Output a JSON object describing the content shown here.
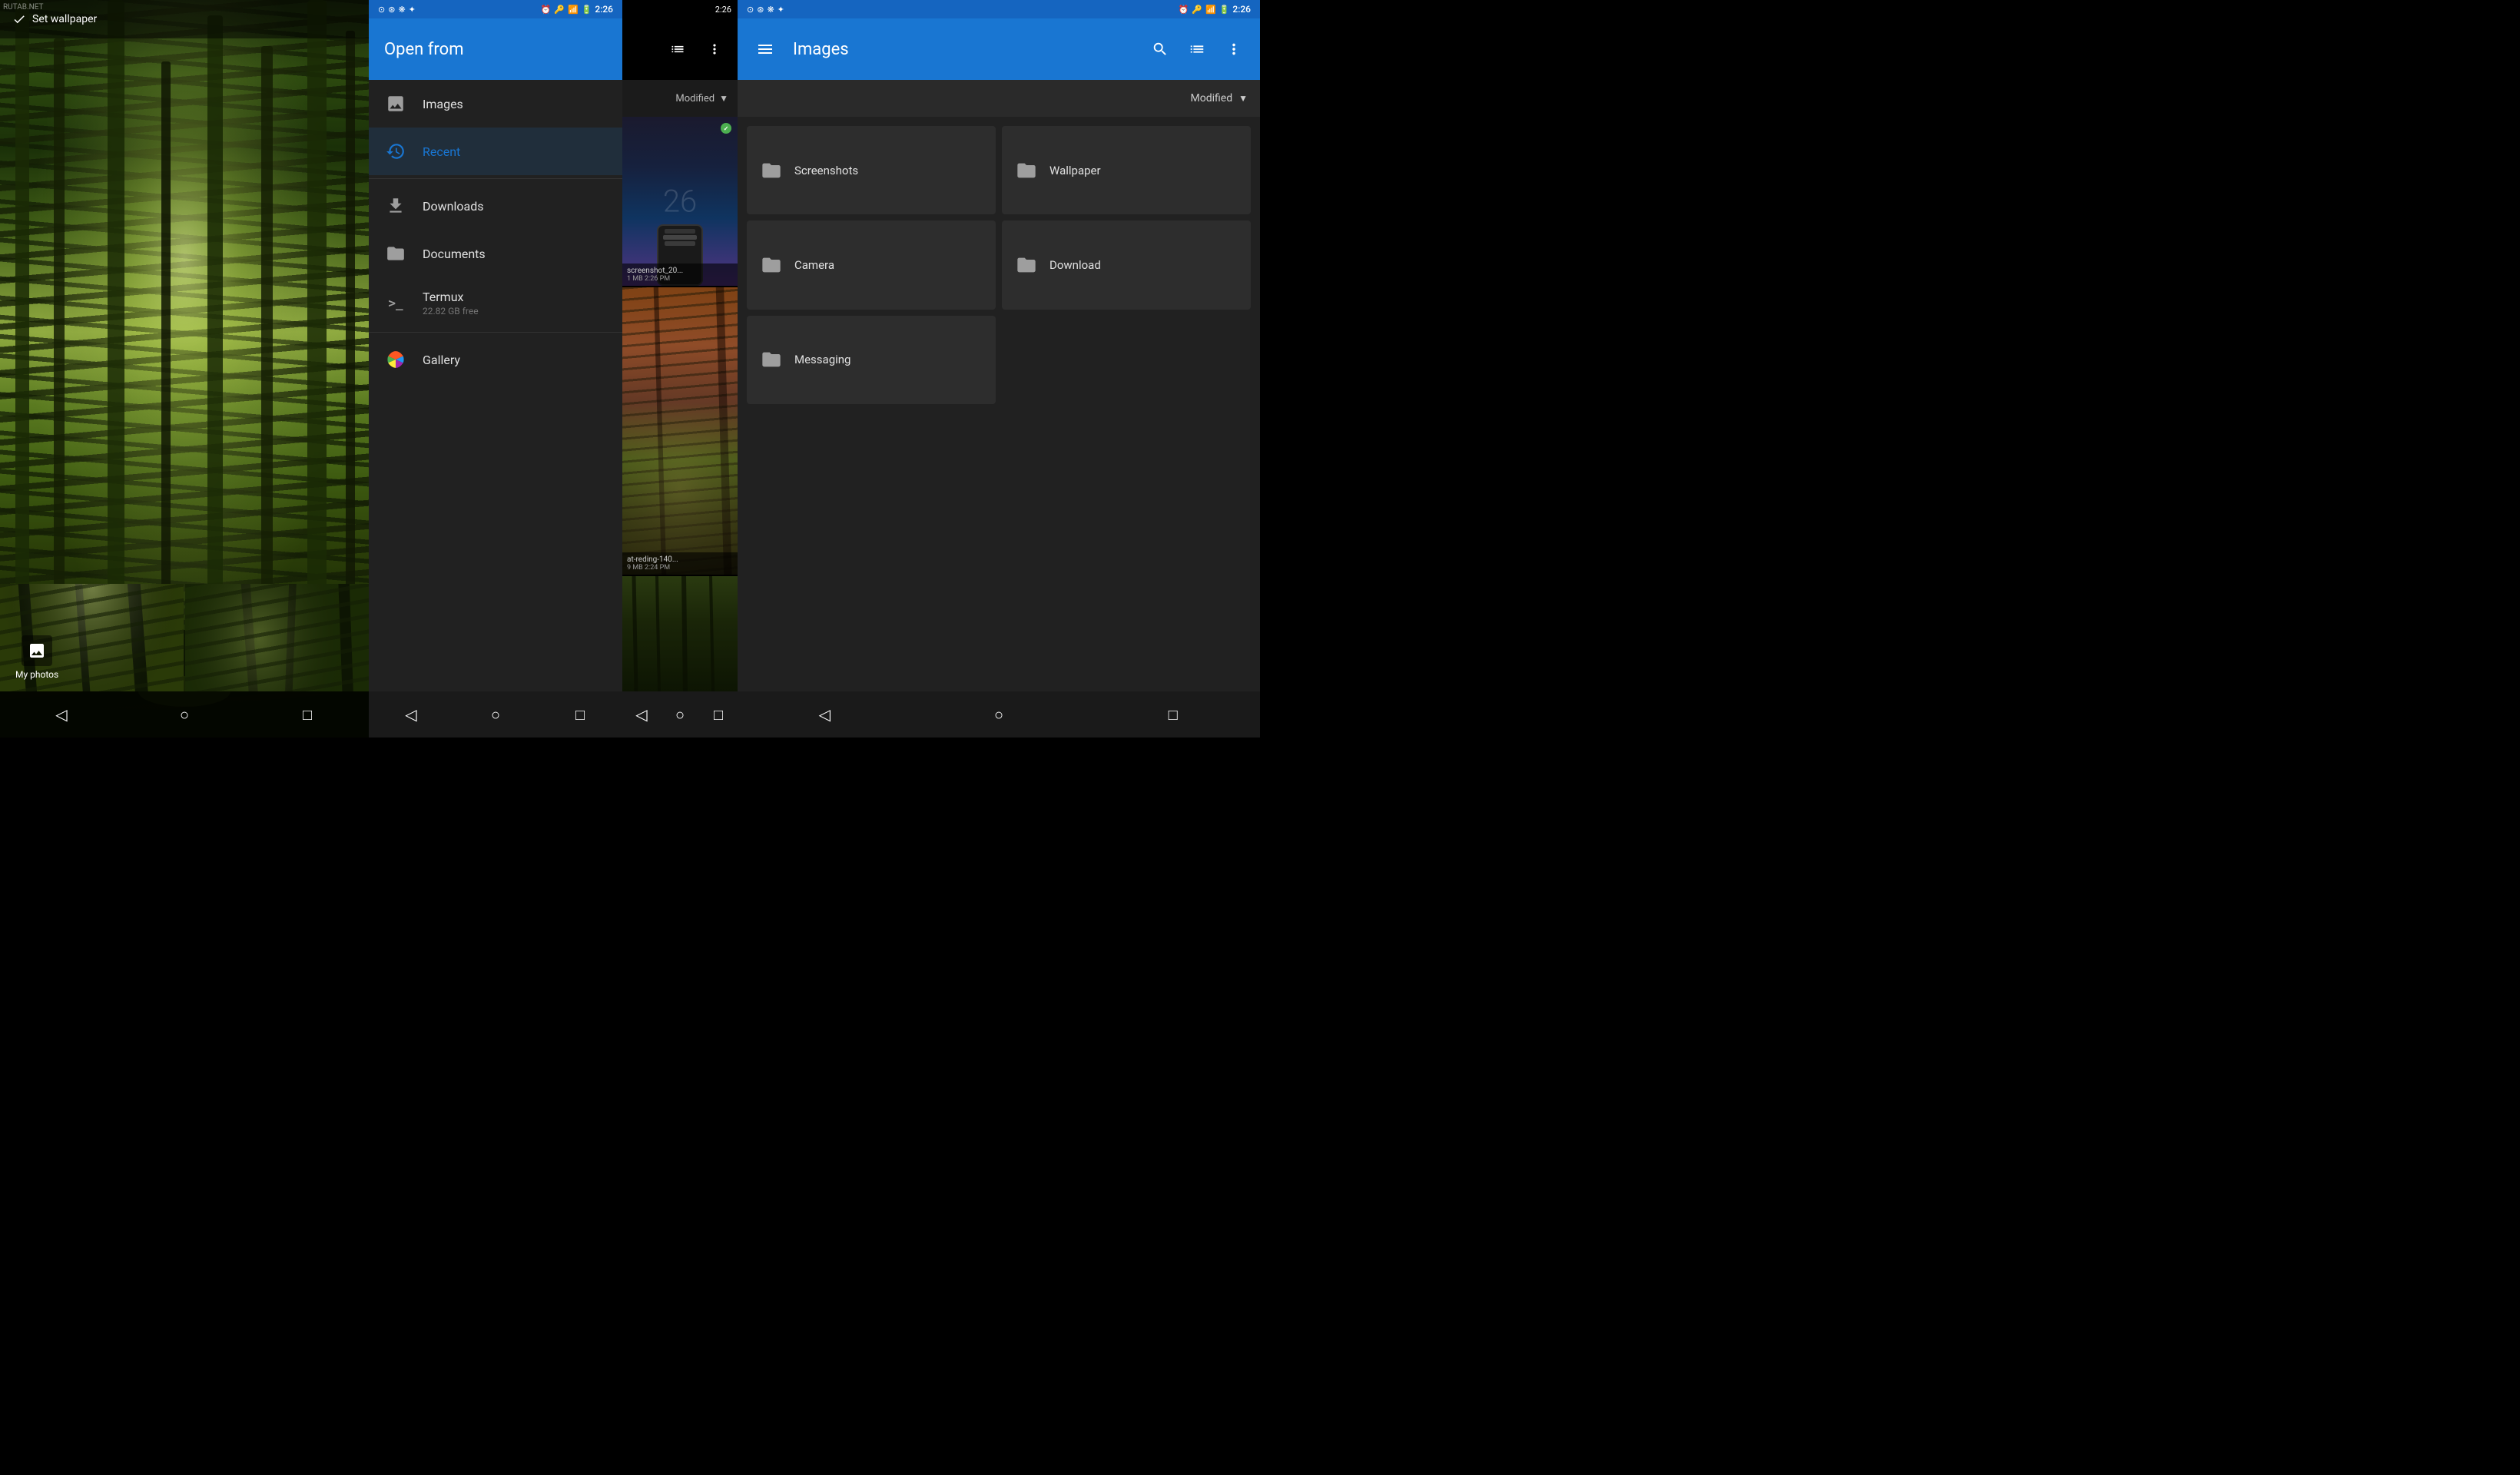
{
  "watermark": "RUTAB.NET",
  "panels": {
    "wallpaper": {
      "set_wallpaper_label": "Set wallpaper",
      "myphotos_label": "My photos",
      "nav": {
        "back": "◁",
        "home": "○",
        "recent": "□"
      }
    },
    "drawer": {
      "title": "Open from",
      "items": [
        {
          "icon": "🖼",
          "label": "Images",
          "sublabel": "",
          "active": false
        },
        {
          "icon": "🕐",
          "label": "Recent",
          "sublabel": "",
          "active": true
        },
        {
          "icon": "⬇",
          "label": "Downloads",
          "sublabel": "",
          "active": false
        },
        {
          "icon": "📁",
          "label": "Documents",
          "sublabel": "",
          "active": false
        },
        {
          "icon": ">_",
          "label": "Termux",
          "sublabel": "22.82 GB free",
          "active": false
        },
        {
          "icon": "🎨",
          "label": "Gallery",
          "sublabel": "",
          "active": false
        }
      ],
      "sort_label": "Modified",
      "status_left": "⊙ ⊛ ❋ ✦",
      "status_time": "2:26",
      "nav": {
        "back": "◁",
        "home": "○",
        "recent": "□"
      },
      "thumb1_name": "screenshot_20...",
      "thumb1_meta": "1 MB  2:26 PM",
      "thumb2_name": "at-reding-140...",
      "thumb2_meta": "9 MB  2:24 PM"
    },
    "images": {
      "title": "Images",
      "sort_label": "Modified",
      "folders": [
        {
          "name": "Screenshots"
        },
        {
          "name": "Wallpaper"
        },
        {
          "name": "Camera"
        },
        {
          "name": "Download"
        },
        {
          "name": "Messaging"
        }
      ],
      "status_left": "⊙ ⊛ ❋ ✦",
      "status_time": "2:26",
      "nav": {
        "back": "◁",
        "home": "○",
        "recent": "□"
      }
    }
  }
}
